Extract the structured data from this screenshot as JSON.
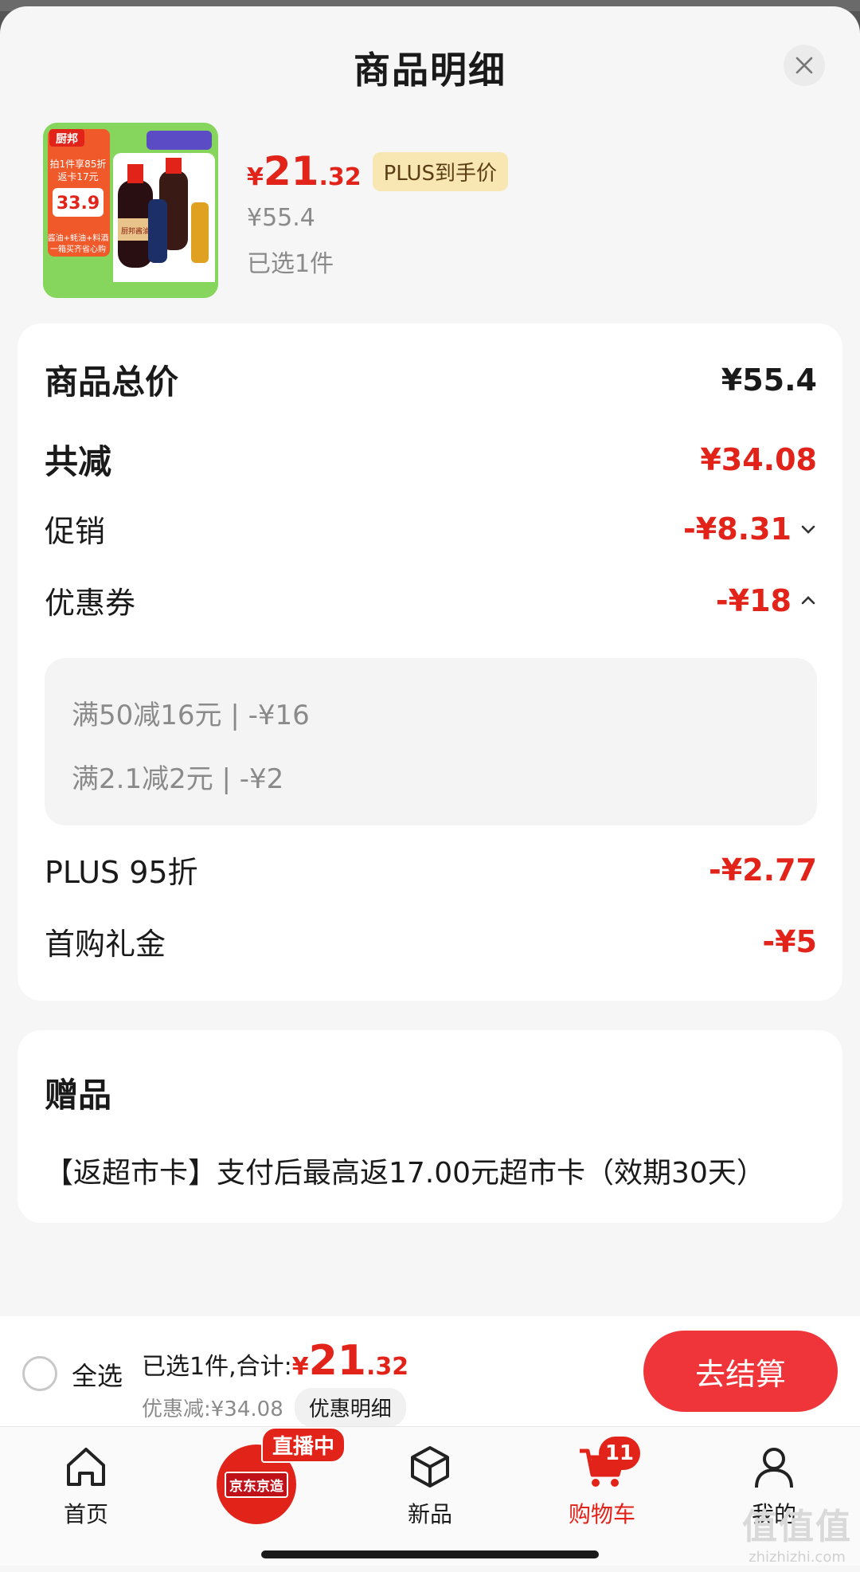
{
  "sheet": {
    "title": "商品明细"
  },
  "product": {
    "price_currency": "¥",
    "price_integer": "21",
    "price_decimal": ".32",
    "plus_tag": "PLUS到手价",
    "original_price": "¥55.4",
    "selected_count": "已选1件",
    "thumb": {
      "brand": "厨邦",
      "promo_line1": "拍1件享85折",
      "promo_line2": "返卡17元",
      "promo_price": "33.9",
      "promo_bottom1": "酱油+蚝油+料酒",
      "promo_bottom2": "一箱买齐省心购",
      "bottle_label": "厨邦酱油"
    }
  },
  "price_detail": {
    "total_label": "商品总价",
    "total_value": "¥55.4",
    "reduce_label": "共减",
    "reduce_value": "¥34.08",
    "promo_label": "促销",
    "promo_value": "-¥8.31",
    "coupon_label": "优惠券",
    "coupon_value": "-¥18",
    "coupons": [
      "满50减16元 | -¥16",
      "满2.1减2元 | -¥2"
    ],
    "plus_label": "PLUS 95折",
    "plus_value": "-¥2.77",
    "first_buy_label": "首购礼金",
    "first_buy_value": "-¥5"
  },
  "gift": {
    "title": "赠品",
    "text": "【返超市卡】支付后最高返17.00元超市卡（效期30天）"
  },
  "checkout": {
    "select_all": "全选",
    "summary_prefix": "已选1件,合计:",
    "amount_currency": "¥",
    "amount_integer": "21",
    "amount_decimal": ".32",
    "discount_text": "优惠减:¥34.08",
    "discount_detail_button": "优惠明细",
    "checkout_button": "去结算"
  },
  "tabbar": {
    "items": [
      {
        "label": "首页",
        "icon": "home-icon"
      },
      {
        "label": "京东京造",
        "icon": "jingzao-logo",
        "tag": "直播中"
      },
      {
        "label": "新品",
        "icon": "box-icon"
      },
      {
        "label": "购物车",
        "icon": "cart-icon",
        "badge": "11"
      },
      {
        "label": "我的",
        "icon": "user-icon"
      }
    ]
  },
  "watermark": {
    "text": "zhizhizhi.com",
    "logo": "值值值"
  },
  "colors": {
    "accent": "#e2231a",
    "checkout_button": "#f0353a",
    "plus_tag_bg": "#f8e6b3"
  }
}
